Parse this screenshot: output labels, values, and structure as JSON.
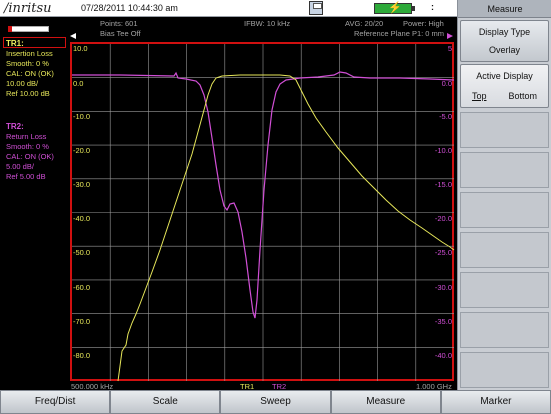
{
  "header": {
    "logo": "/inritsu",
    "datetime": "07/28/2011 10:44:30 am",
    "colon": ":",
    "save_icon": "save-icon",
    "battery_icon": "battery-icon"
  },
  "status": {
    "points": "Points: 601",
    "ifbw": "IFBW: 10 kHz",
    "avg": "AVG: 20/20",
    "power": "Power: High",
    "bias_tee": "Bias Tee Off",
    "ref_plane": "Reference Plane P1: 0 mm"
  },
  "side_panel": {
    "title": "Measure",
    "display_type_label": "Display Type",
    "display_type_value": "Overlay",
    "active_display_label": "Active Display",
    "active_top": "Top",
    "active_bottom": "Bottom"
  },
  "bottom_menu": [
    "Freq/Dist",
    "Scale",
    "Sweep",
    "Measure",
    "Marker"
  ],
  "trace1": {
    "title": "TR1:",
    "lines": [
      "Insertion Loss",
      "Smooth: 0 %",
      "CAL: ON (OK)",
      "10.00 dB/",
      "Ref 10.00 dB"
    ]
  },
  "trace2": {
    "title": "TR2:",
    "lines": [
      "Return Loss",
      "Smooth: 0 %",
      "CAL: ON (OK)",
      "5.00 dB/",
      "Ref 5.00 dB"
    ]
  },
  "axis": {
    "start": "500.000 kHz",
    "stop": "1.000 GHz",
    "tr1_label": "TR1",
    "tr2_label": "TR2",
    "left_ticks": [
      "10.0",
      "0.0",
      "-10.0",
      "-20.0",
      "-30.0",
      "-40.0",
      "-50.0",
      "-60.0",
      "-70.0",
      "-80.0"
    ],
    "right_ticks": [
      "5",
      "0.0",
      "-5.0",
      "-10.0",
      "-15.0",
      "-20.0",
      "-25.0",
      "-30.0",
      "-35.0",
      "-40.0"
    ]
  },
  "colors": {
    "tr1": "#e7e75a",
    "tr2": "#d14fd6",
    "grid": "#9a9a9a",
    "frame": "#d01010"
  }
}
